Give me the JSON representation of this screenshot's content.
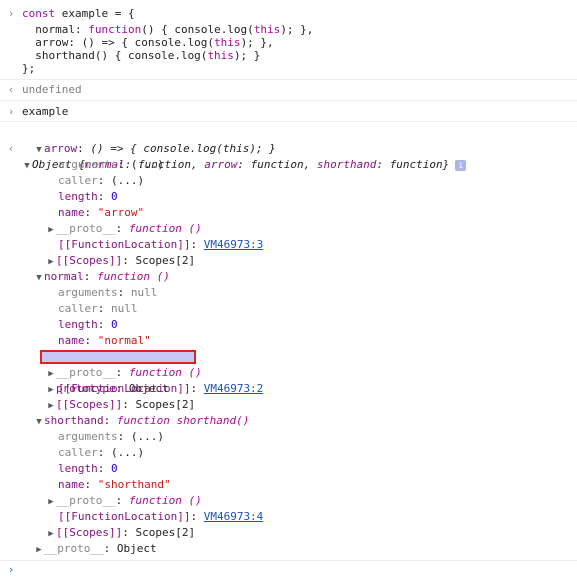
{
  "input": {
    "lines": [
      "const example = {",
      "  normal: function() { console.log(this); },",
      "  arrow: () => { console.log(this); },",
      "  shorthand() { console.log(this); }",
      "};"
    ]
  },
  "result1": "undefined",
  "input2": "example",
  "object": {
    "summary_prefix": "Object {",
    "summary_key1": "normal",
    "summary_val1": "function",
    "summary_key2": "arrow",
    "summary_val2": "function",
    "summary_key3": "shorthand",
    "summary_val3": "function",
    "summary_suffix": "}",
    "info_icon": "i"
  },
  "arrow": {
    "key": "arrow",
    "value": "() => { console.log(this); }",
    "arguments_key": "arguments",
    "arguments_val": "(...)",
    "caller_key": "caller",
    "caller_val": "(...)",
    "length_key": "length",
    "length_val": "0",
    "name_key": "name",
    "name_val": "\"arrow\"",
    "proto_key": "__proto__",
    "proto_val": "function ()",
    "loc_key": "[[FunctionLocation]]",
    "loc_val": "VM46973:3",
    "scopes_key": "[[Scopes]]",
    "scopes_val": "Scopes[2]"
  },
  "normal": {
    "key": "normal",
    "value": "function ()",
    "arguments_key": "arguments",
    "arguments_val": "null",
    "caller_key": "caller",
    "caller_val": "null",
    "length_key": "length",
    "length_val": "0",
    "name_key": "name",
    "name_val": "\"normal\"",
    "prototype_key": "prototype",
    "prototype_val": "Object",
    "proto_key": "__proto__",
    "proto_val": "function ()",
    "loc_key": "[[FunctionLocation]]",
    "loc_val": "VM46973:2",
    "scopes_key": "[[Scopes]]",
    "scopes_val": "Scopes[2]"
  },
  "shorthand": {
    "key": "shorthand",
    "value": "function shorthand()",
    "arguments_key": "arguments",
    "arguments_val": "(...)",
    "caller_key": "caller",
    "caller_val": "(...)",
    "length_key": "length",
    "length_val": "0",
    "name_key": "name",
    "name_val": "\"shorthand\"",
    "proto_key": "__proto__",
    "proto_val": "function ()",
    "loc_key": "[[FunctionLocation]]",
    "loc_val": "VM46973:4",
    "scopes_key": "[[Scopes]]",
    "scopes_val": "Scopes[2]"
  },
  "object_proto": {
    "key": "__proto__",
    "value": "Object"
  },
  "colors": {
    "highlight_border": "#e0241c",
    "highlight_fill": "#c7c7f4",
    "link": "#1a55b6",
    "keyword": "#a90d91",
    "string": "#c41a16",
    "number": "#1c00cf"
  }
}
